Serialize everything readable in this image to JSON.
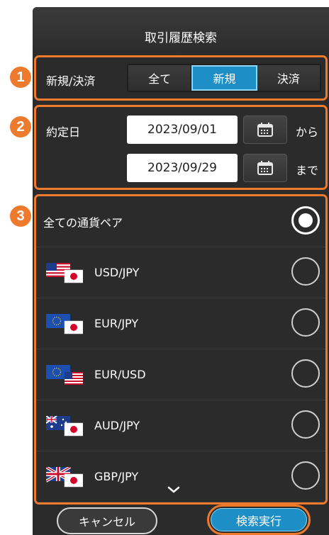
{
  "header": {
    "title": "取引履歴検索"
  },
  "badges": [
    "1",
    "2",
    "3"
  ],
  "type_filter": {
    "label": "新規/決済",
    "options": [
      "全て",
      "新規",
      "決済"
    ],
    "selected": "新規"
  },
  "date_filter": {
    "label": "約定日",
    "from_date": "2023/09/01",
    "from_suffix": "から",
    "to_date": "2023/09/29",
    "to_suffix": "まで"
  },
  "currency_pairs": {
    "all_label": "全ての通貨ペア",
    "selected": "全ての通貨ペア",
    "items": [
      "USD/JPY",
      "EUR/JPY",
      "EUR/USD",
      "AUD/JPY",
      "GBP/JPY"
    ]
  },
  "footer": {
    "cancel_label": "キャンセル",
    "search_label": "検索実行"
  },
  "colors": {
    "accent": "#ee7a2e",
    "active_blue": "#1e8fc6",
    "panel_bg": "#2b2b2b"
  }
}
